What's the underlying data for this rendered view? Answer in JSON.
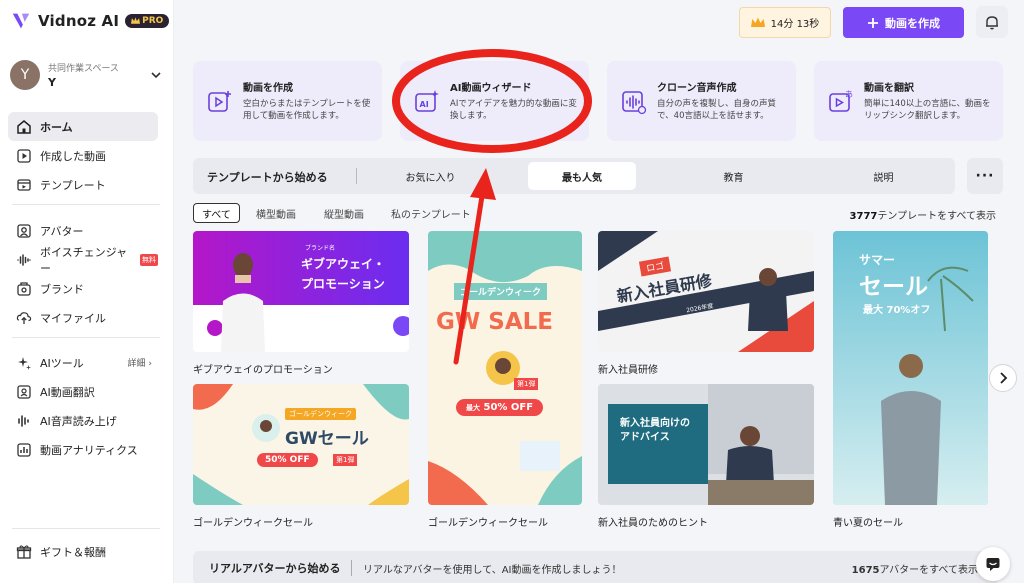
{
  "app": {
    "name": "Vidnoz AI",
    "plan_badge": "PRO"
  },
  "workspace": {
    "label": "共同作業スペース",
    "user": "Y",
    "avatar_initial": "Y"
  },
  "sidebar": {
    "main_items": [
      {
        "label": "ホーム",
        "icon": "home-icon",
        "active": true
      },
      {
        "label": "作成した動画",
        "icon": "video-icon"
      },
      {
        "label": "テンプレート",
        "icon": "template-icon"
      }
    ],
    "asset_items": [
      {
        "label": "アバター",
        "icon": "avatar-icon"
      },
      {
        "label": "ボイスチェンジャー",
        "icon": "voice-icon",
        "badge": "無料"
      },
      {
        "label": "ブランド",
        "icon": "brand-icon"
      },
      {
        "label": "マイファイル",
        "icon": "upload-icon"
      }
    ],
    "tools_section": {
      "label": "AIツール",
      "detail": "詳細"
    },
    "tool_items": [
      {
        "label": "AI動画翻訳",
        "icon": "translate-icon"
      },
      {
        "label": "AI音声読み上げ",
        "icon": "audio-icon"
      },
      {
        "label": "動画アナリティクス",
        "icon": "analytics-icon"
      }
    ],
    "bottom_item": {
      "label": "ギフト＆報酬",
      "icon": "gift-icon"
    }
  },
  "topbar": {
    "time_remaining": "14分 13秒",
    "create_button": "動画を作成"
  },
  "action_cards": [
    {
      "title": "動画を作成",
      "desc": "空白からまたはテンプレートを使用して動画を作成します。",
      "icon": "create-video-icon"
    },
    {
      "title": "AI動画ウィザード",
      "desc": "AIでアイデアを魅力的な動画に変換します。",
      "icon": "ai-wizard-icon"
    },
    {
      "title": "クローン音声作成",
      "desc": "自分の声を複製し、自身の声質で、40言語以上を話せます。",
      "icon": "voice-clone-icon"
    },
    {
      "title": "動画を翻訳",
      "desc": "簡単に140以上の言語に、動画をリップシンク翻訳します。",
      "icon": "translate-video-icon"
    }
  ],
  "templates_bar": {
    "title": "テンプレートから始める",
    "tabs": [
      "お気に入り",
      "最も人気",
      "教育",
      "説明"
    ],
    "active_tab": "最も人気"
  },
  "filters": [
    "すべて",
    "横型動画",
    "縦型動画",
    "私のテンプレート"
  ],
  "show_all": {
    "count": "3777",
    "text": "テンプレートをすべて表示"
  },
  "templates": [
    {
      "caption": "ギブアウェイのプロモーション",
      "art_title_1": "ギブアウェイ・",
      "art_title_2": "プロモーション",
      "art_tag": "ブランド名"
    },
    {
      "caption": "ゴールデンウィークセール",
      "art_title_1": "GWセール",
      "art_tag": "ゴールデンウィーク",
      "art_offer": "50% OFF",
      "art_stamp": "第1弾"
    },
    {
      "caption": "ゴールデンウィークセール",
      "art_title_1": "GW SALE",
      "art_tag": "ゴールデンウィーク",
      "art_offer": "50% OFF",
      "art_offer_label": "最大",
      "art_stamp": "第1弾"
    },
    {
      "caption": "新入社員研修",
      "art_title_1": "新入社員研修",
      "art_tag": "ロゴ",
      "art_year": "2026年度"
    },
    {
      "caption": "新入社員のためのヒント",
      "art_title_1": "新入社員向けの",
      "art_title_2": "アドバイス"
    },
    {
      "caption": "青い夏のセール",
      "art_title_1": "サマー",
      "art_title_2": "セール",
      "art_offer": "最大 70%オフ"
    }
  ],
  "avatar_bar": {
    "title": "リアルアバターから始める",
    "desc": "リアルなアバターを使用して、AI動画を作成しましょう！",
    "count": "1675",
    "count_text": "アバターをすべて表示"
  },
  "colors": {
    "brand_purple": "#7b48f5",
    "annotation_red": "#e8241c",
    "card_bg": "#eeecfb"
  }
}
